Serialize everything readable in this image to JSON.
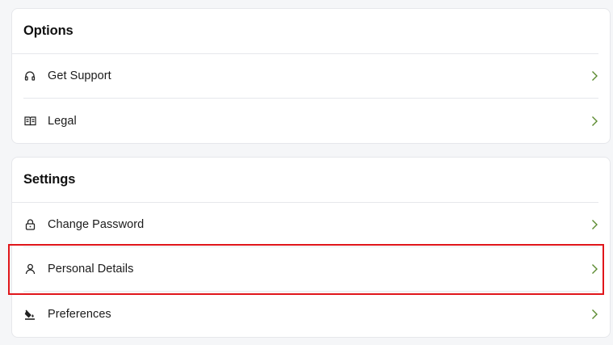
{
  "options": {
    "title": "Options",
    "items": [
      {
        "label": "Get Support",
        "icon": "headphones-icon"
      },
      {
        "label": "Legal",
        "icon": "book-icon"
      }
    ]
  },
  "settings": {
    "title": "Settings",
    "items": [
      {
        "label": "Change Password",
        "icon": "lock-icon"
      },
      {
        "label": "Personal Details",
        "icon": "user-icon"
      },
      {
        "label": "Preferences",
        "icon": "paint-bucket-icon"
      }
    ]
  },
  "colors": {
    "chevron": "#5a8a2e",
    "highlight": "#e0161b"
  }
}
